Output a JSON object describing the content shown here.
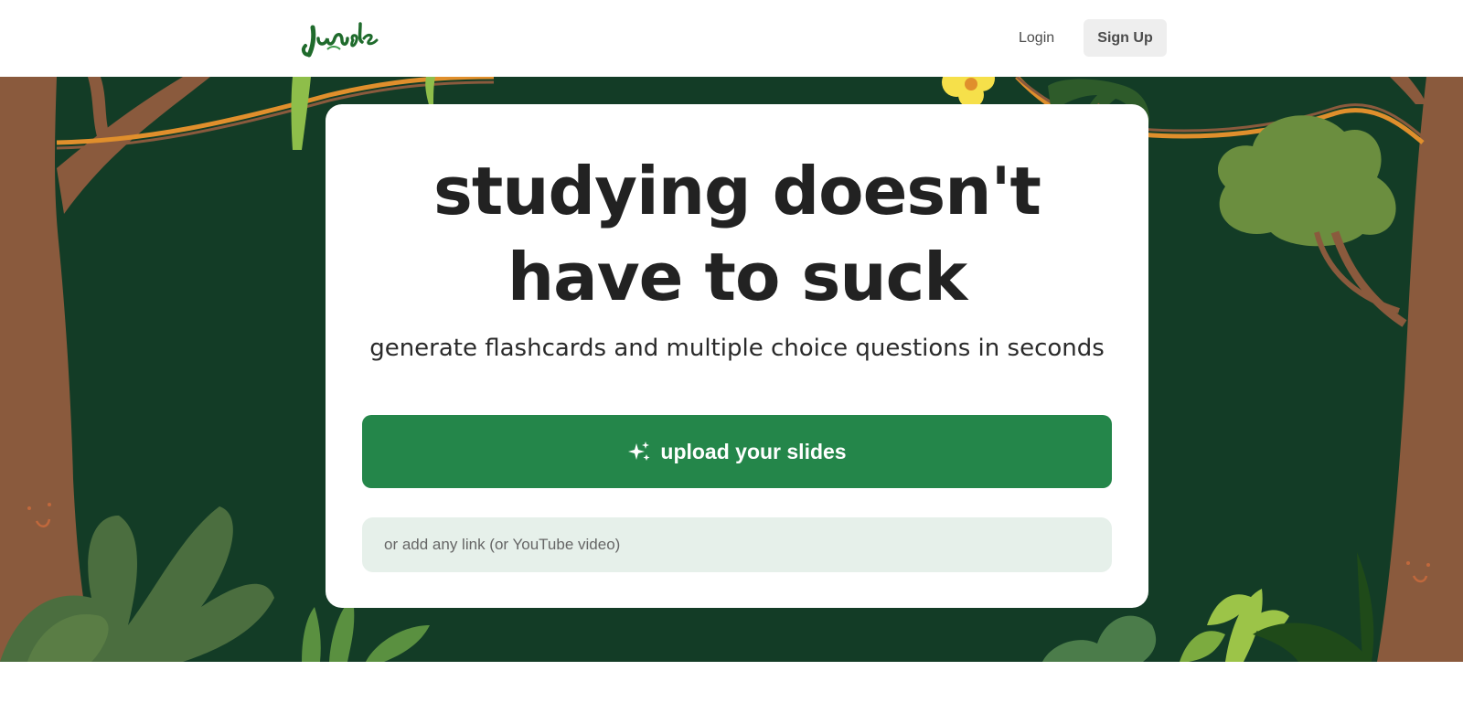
{
  "nav": {
    "logo_text": "Jungle",
    "login_label": "Login",
    "signup_label": "Sign Up"
  },
  "hero": {
    "headline_line1": "studying doesn't",
    "headline_line2": "have to suck",
    "subline": "generate flashcards and multiple choice questions in seconds",
    "upload_label": "upload your slides",
    "link_placeholder": "or add any link (or YouTube video)"
  },
  "colors": {
    "jungle_bg": "#133c26",
    "primary_button": "#24864a",
    "input_bg": "#e6f0ea",
    "trunk": "#8a5a3d",
    "vine": "#e08f2c"
  }
}
